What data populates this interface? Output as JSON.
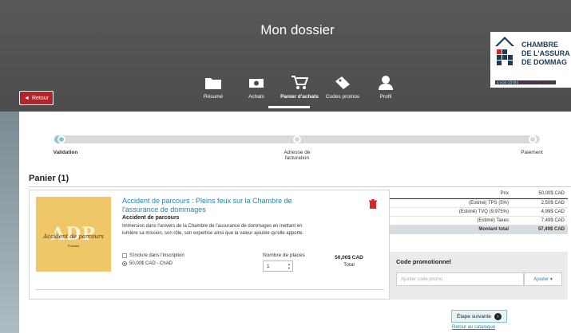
{
  "header": {
    "title": "Mon dossier",
    "back_label": "Retour"
  },
  "brand": {
    "name_line1": "CHAMBRE",
    "name_line2": "DE L'ASSURA",
    "name_line3": "DE DOMMAG",
    "tagline_a": "À VOS CÔTÉS",
    "tagline_b": "POUR PERFECTIONNE",
    "colors": {
      "navy": "#1f3a57",
      "red": "#d4272c"
    }
  },
  "nav": {
    "items": [
      {
        "label": "Résumé",
        "icon": "folder-icon"
      },
      {
        "label": "Achats",
        "icon": "money-icon"
      },
      {
        "label": "Panier d'achats",
        "icon": "cart-icon",
        "active": true
      },
      {
        "label": "Codes promos",
        "icon": "tag-icon"
      },
      {
        "label": "Profil",
        "icon": "user-icon"
      }
    ]
  },
  "steps": [
    {
      "label": "Validation",
      "active": true
    },
    {
      "label": "Adresse de facturation",
      "active": false
    },
    {
      "label": "Paiement",
      "active": false
    }
  ],
  "cart": {
    "title": "Panier (1)",
    "item": {
      "thumb_big": "ADP",
      "thumb_script": "Accident de parcours",
      "thumb_small": "Podcast",
      "title": "Accident de parcours : Pleins feux sur la Chambre de l'assurance de dommages",
      "subtitle": "Accident de parcours",
      "description": "Immersion dans l'univers de la Chambre de l'assurance de dommages en mettant en lumière sa mission, son rôle, son expertise ainsi que la valeur ajoutée qu'elle apporte.",
      "checkbox_label": "S'inclure dans l'inscription",
      "radio_label": "50,00$ CAD - ChAD",
      "qty_label": "Nombre de places",
      "qty_value": "1",
      "price": "50,00$ CAD",
      "price_caption": "Total"
    }
  },
  "summary": {
    "rows": [
      {
        "label": "Prix",
        "value": "50,00$ CAD"
      },
      {
        "label": "(Estimé) TPS (5%)",
        "value": "2,50$ CAD"
      },
      {
        "label": "(Estimé) TVQ (9,975%)",
        "value": "4,99$ CAD"
      },
      {
        "label": "(Estimé) Taxes",
        "value": "7,49$ CAD"
      }
    ],
    "total": {
      "label": "Montant total",
      "value": "57,49$ CAD"
    }
  },
  "promo": {
    "title": "Code promotionnel",
    "placeholder": "Ajouter code promo",
    "button": "Ajouter"
  },
  "actions": {
    "next": "Étape suivante",
    "catalog": "Retour au catalogue"
  }
}
